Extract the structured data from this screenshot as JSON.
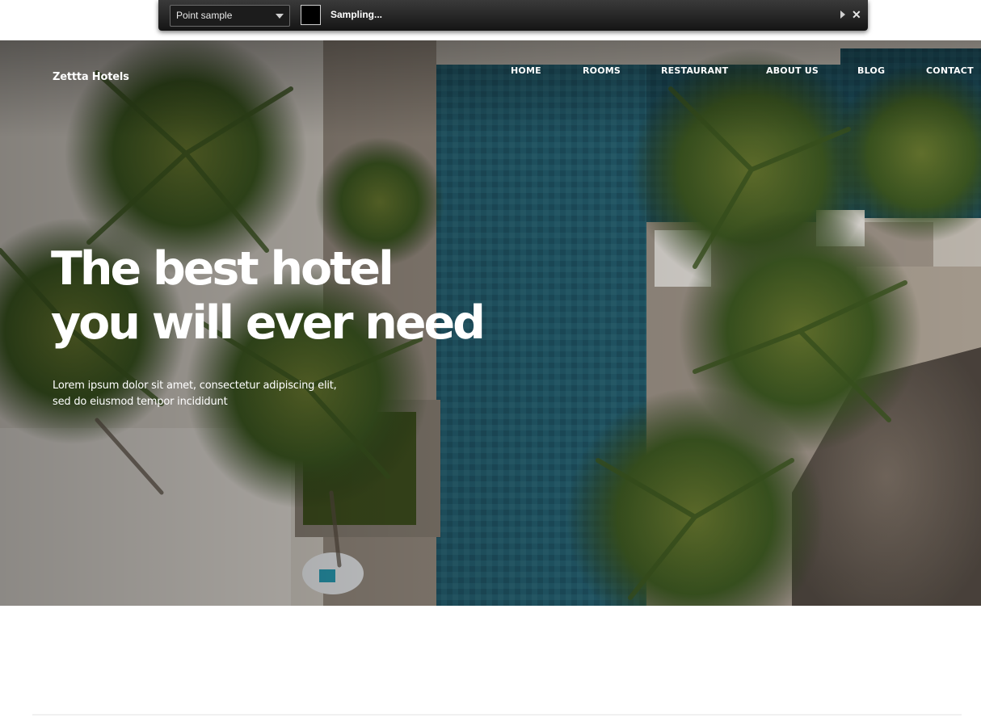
{
  "toolbar": {
    "sample_mode": "Point sample",
    "status_text": "Sampling...",
    "swatch_color": "#000000",
    "play_icon": "play-triangle-icon",
    "close_icon": "close-icon"
  },
  "site": {
    "brand": "Zettta Hotels",
    "nav": [
      "HOME",
      "ROOMS",
      "RESTAURANT",
      "ABOUT US",
      "BLOG",
      "CONTACT"
    ]
  },
  "hero": {
    "headline_line1": "The best hotel",
    "headline_line2": "you will ever need",
    "subtext": "Lorem ipsum dolor sit amet, consectetur adipiscing elit, sed do eiusmod tempor incididunt",
    "image": "aerial-resort-pool-palm-trees"
  },
  "colors": {
    "pool": "#1f5a6e",
    "palm": "#4a6a2a",
    "sand": "#d8d2c9",
    "toolbar_bg": "#1a1a1a"
  }
}
